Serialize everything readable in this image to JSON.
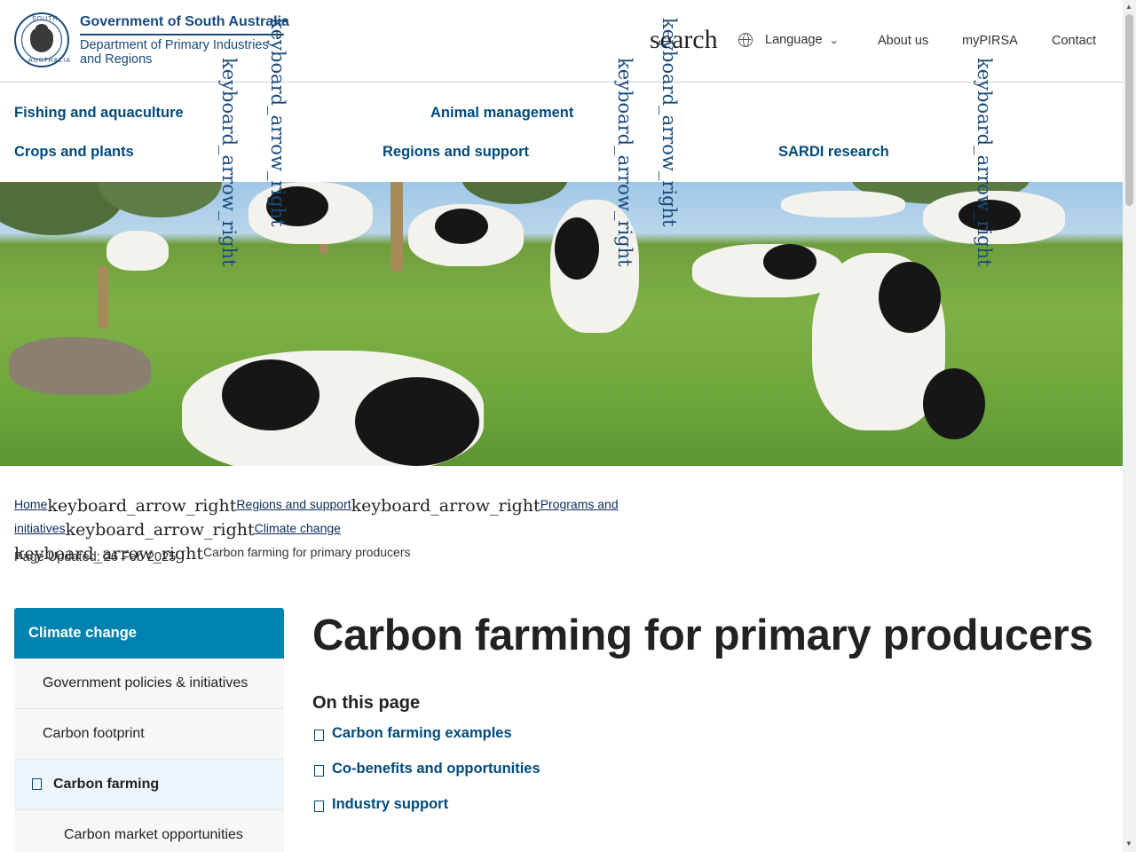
{
  "header": {
    "gov_name": "Government of South Australia",
    "dept_line1": "Department of Primary Industries",
    "dept_line2": "and Regions",
    "crest_top_text": "SOUTH",
    "crest_bottom_text": "AUSTRALIA",
    "search_label": "search",
    "language_label": "Language",
    "links": [
      "About us",
      "myPIRSA",
      "Contact"
    ]
  },
  "icon_text": {
    "arrow": "keyboard_arrow_right"
  },
  "nav": {
    "items": [
      "Fishing and aquaculture",
      "Animal management",
      "Crops and plants",
      "Regions and support",
      "SARDI research"
    ]
  },
  "breadcrumb": {
    "items": [
      "Home",
      "Regions and support",
      "Programs and initiatives",
      "Climate change"
    ],
    "current": "Carbon farming for primary producers"
  },
  "updated": "Page Updated: 26 Feb 2025",
  "sidenav": {
    "heading": "Climate change",
    "items": [
      "Government policies & initiatives",
      "Carbon footprint",
      "Carbon farming",
      "Carbon market opportunities"
    ]
  },
  "main": {
    "title": "Carbon farming for primary producers",
    "on_this_page": "On this page",
    "anchors": [
      "Carbon farming examples",
      "Co-benefits and opportunities",
      "Industry support"
    ]
  },
  "colors": {
    "brand_navy": "#1a4a7a",
    "link_blue": "#004a7c",
    "sidenav_accent": "#0083b0"
  }
}
